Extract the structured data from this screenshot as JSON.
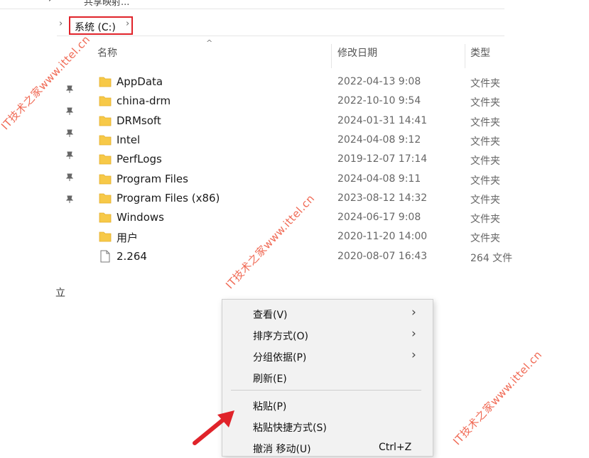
{
  "ribbon": {
    "fragments": [
      "→",
      "共享映射..."
    ]
  },
  "address": {
    "root_chevron": "›",
    "crumb": "系统 (C:)",
    "after_chevron": "›"
  },
  "columns": {
    "name": "名称",
    "date": "修改日期",
    "type": "类型",
    "sort_indicator": "^"
  },
  "files": [
    {
      "name": "AppData",
      "date": "2022-04-13 9:08",
      "type": "文件夹",
      "icon": "folder-icon"
    },
    {
      "name": "china-drm",
      "date": "2022-10-10 9:54",
      "type": "文件夹",
      "icon": "folder-icon"
    },
    {
      "name": "DRMsoft",
      "date": "2024-01-31 14:41",
      "type": "文件夹",
      "icon": "folder-icon"
    },
    {
      "name": "Intel",
      "date": "2024-04-08 9:12",
      "type": "文件夹",
      "icon": "folder-icon"
    },
    {
      "name": "PerfLogs",
      "date": "2019-12-07 17:14",
      "type": "文件夹",
      "icon": "folder-icon"
    },
    {
      "name": "Program Files",
      "date": "2024-04-08 9:11",
      "type": "文件夹",
      "icon": "folder-icon"
    },
    {
      "name": "Program Files (x86)",
      "date": "2023-08-12 14:32",
      "type": "文件夹",
      "icon": "folder-icon"
    },
    {
      "name": "Windows",
      "date": "2024-06-17 9:08",
      "type": "文件夹",
      "icon": "folder-icon"
    },
    {
      "name": "用户",
      "date": "2020-11-20 14:00",
      "type": "文件夹",
      "icon": "folder-icon"
    },
    {
      "name": "2.264",
      "date": "2020-08-07 16:43",
      "type": "264 文件",
      "icon": "file-icon"
    }
  ],
  "nav": {
    "fragment": "立"
  },
  "context_menu": {
    "items": [
      {
        "label": "查看(V)",
        "submenu": "›"
      },
      {
        "label": "排序方式(O)",
        "submenu": "›"
      },
      {
        "label": "分组依据(P)",
        "submenu": "›"
      },
      {
        "label": "刷新(E)"
      },
      {
        "label": "粘贴(P)"
      },
      {
        "label": "粘贴快捷方式(S)"
      },
      {
        "label": "撤消 移动(U)",
        "shortcut": "Ctrl+Z"
      }
    ]
  },
  "watermark": {
    "text": "IT技术之家www.ittel.cn"
  },
  "colors": {
    "accent_red": "#e0232a",
    "folder": "#f7c948",
    "watermark": "#f06a55"
  }
}
